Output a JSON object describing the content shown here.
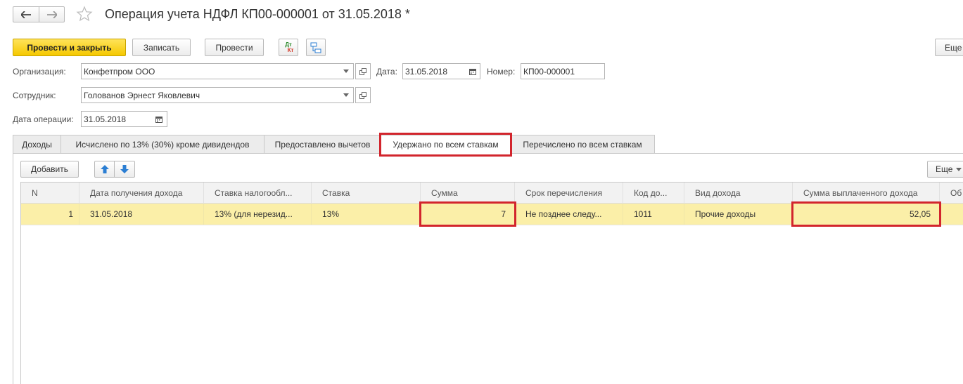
{
  "title": "Операция учета НДФЛ КП00-000001 от 31.05.2018 *",
  "toolbar": {
    "post_close": "Провести и закрыть",
    "save": "Записать",
    "post": "Провести",
    "dtkt_top": "Дт",
    "dtkt_bottom": "Кт",
    "more": "Еще"
  },
  "form": {
    "org_label": "Организация:",
    "org_value": "Конфетпром ООО",
    "date_label": "Дата:",
    "date_value": "31.05.2018",
    "number_label": "Номер:",
    "number_value": "КП00-000001",
    "employee_label": "Сотрудник:",
    "employee_value": "Голованов Эрнест Яковлевич",
    "op_date_label": "Дата операции:",
    "op_date_value": "31.05.2018"
  },
  "tabs": [
    {
      "label": "Доходы"
    },
    {
      "label": "Исчислено по 13% (30%) кроме дивидендов"
    },
    {
      "label": "Предоставлено вычетов"
    },
    {
      "label": "Удержано по всем ставкам"
    },
    {
      "label": "Перечислено по всем ставкам"
    }
  ],
  "table_toolbar": {
    "add": "Добавить",
    "more": "Еще"
  },
  "table": {
    "columns": [
      "N",
      "Дата получения дохода",
      "Ставка налогообл...",
      "Ставка",
      "Сумма",
      "Срок перечисления",
      "Код до...",
      "Вид дохода",
      "Сумма выплаченного дохода",
      "Об"
    ],
    "rows": [
      {
        "n": "1",
        "date": "31.05.2018",
        "tax_rate_type": "13% (для нерезид...",
        "rate": "13%",
        "sum": "7",
        "deadline": "Не позднее следу...",
        "code": "1011",
        "income_type": "Прочие доходы",
        "paid_income": "52,05"
      }
    ]
  },
  "colors": {
    "accent_yellow": "#f5c800",
    "selected_row": "#fbefa8",
    "highlight_red": "#d2252d",
    "arrow_blue": "#2b7ed3"
  }
}
